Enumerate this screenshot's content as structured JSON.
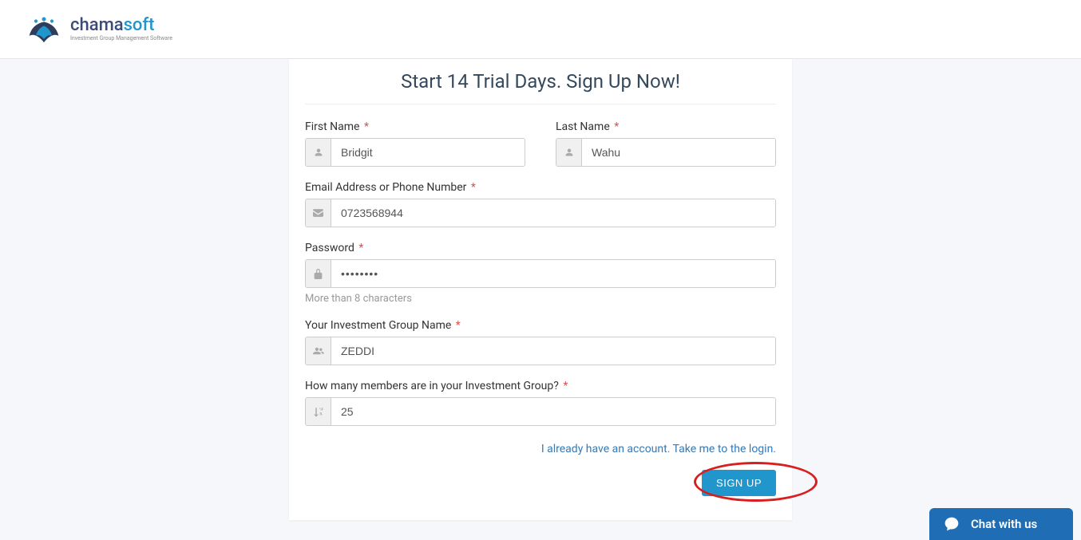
{
  "logo": {
    "chama": "chama",
    "soft": "soft",
    "tagline": "Investment Group Management Software"
  },
  "form": {
    "title": "Start 14 Trial Days. Sign Up Now!",
    "first_name": {
      "label": "First Name",
      "value": "Bridgit"
    },
    "last_name": {
      "label": "Last Name",
      "value": "Wahu"
    },
    "email": {
      "label": "Email Address or Phone Number",
      "value": "0723568944"
    },
    "password": {
      "label": "Password",
      "value": "••••••••",
      "help": "More than 8 characters"
    },
    "group_name": {
      "label": "Your Investment Group Name",
      "value": "ZEDDI"
    },
    "members": {
      "label": "How many members are in your Investment Group?",
      "value": "25"
    },
    "login_link": "I already have an account. Take me to the login.",
    "submit": "SIGN UP"
  },
  "chat": {
    "label": "Chat with us"
  }
}
